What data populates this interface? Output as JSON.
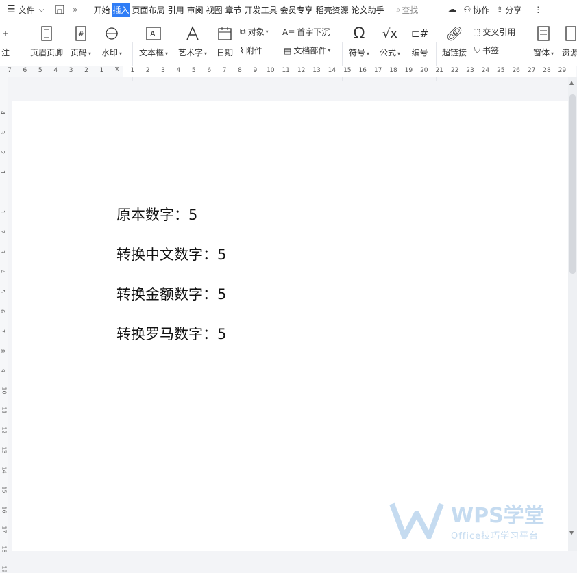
{
  "menubar": {
    "file_label": "文件",
    "tabs": [
      "开始",
      "插入",
      "页面布局",
      "引用",
      "审阅",
      "视图",
      "章节",
      "开发工具",
      "会员专享",
      "稻壳资源",
      "论文助手"
    ],
    "active_tab": "插入",
    "search_label": "查找",
    "collab_label": "协作",
    "share_label": "分享"
  },
  "ribbon": {
    "partial_left": "注",
    "header_footer": "页眉页脚",
    "page_number": "页码",
    "watermark": "水印",
    "textbox": "文本框",
    "wordart": "艺术字",
    "date": "日期",
    "object": "对象",
    "attachment": "附件",
    "dropcap": "首字下沉",
    "doc_parts": "文档部件",
    "symbol": "符号",
    "formula": "公式",
    "numbering": "编号",
    "hyperlink": "超链接",
    "crossref": "交叉引用",
    "bookmark": "书签",
    "window": "窗体",
    "resources": "资源"
  },
  "ruler": {
    "ticks": [
      "7",
      "6",
      "5",
      "4",
      "3",
      "2",
      "1",
      "",
      "1",
      "2",
      "3",
      "4",
      "5",
      "6",
      "7",
      "8",
      "9",
      "10",
      "11",
      "12",
      "13",
      "14",
      "15",
      "16",
      "17",
      "18",
      "19",
      "20",
      "21",
      "22",
      "23",
      "24",
      "25",
      "26",
      "27",
      "28",
      "29"
    ]
  },
  "document": {
    "lines": [
      "原本数字：5",
      "转换中文数字：5",
      "转换金额数字：5",
      "转换罗马数字：5"
    ]
  },
  "watermark": {
    "brand": "WPS学堂",
    "tagline": "Office技巧学习平台"
  },
  "colors": {
    "accent": "#2f7df6",
    "page_bg": "#ffffff",
    "canvas_bg": "#f3f4f7"
  }
}
